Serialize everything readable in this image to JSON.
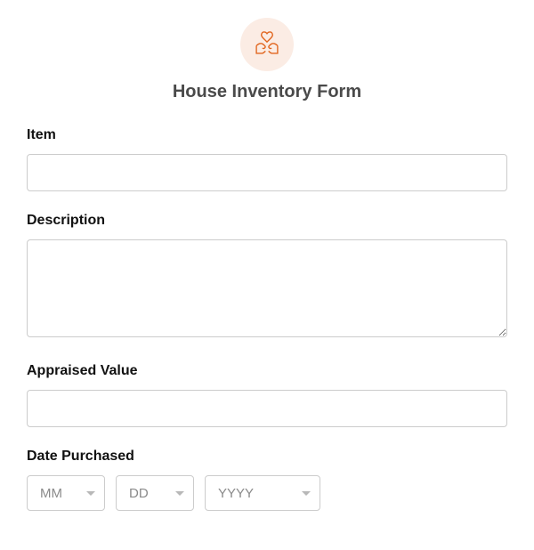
{
  "header": {
    "title": "House Inventory Form",
    "icon": "hands-heart-icon"
  },
  "fields": {
    "item": {
      "label": "Item",
      "value": ""
    },
    "description": {
      "label": "Description",
      "value": ""
    },
    "appraised_value": {
      "label": "Appraised Value",
      "value": ""
    },
    "date_purchased": {
      "label": "Date Purchased",
      "month": {
        "placeholder": "MM",
        "value": ""
      },
      "day": {
        "placeholder": "DD",
        "value": ""
      },
      "year": {
        "placeholder": "YYYY",
        "value": ""
      }
    }
  }
}
